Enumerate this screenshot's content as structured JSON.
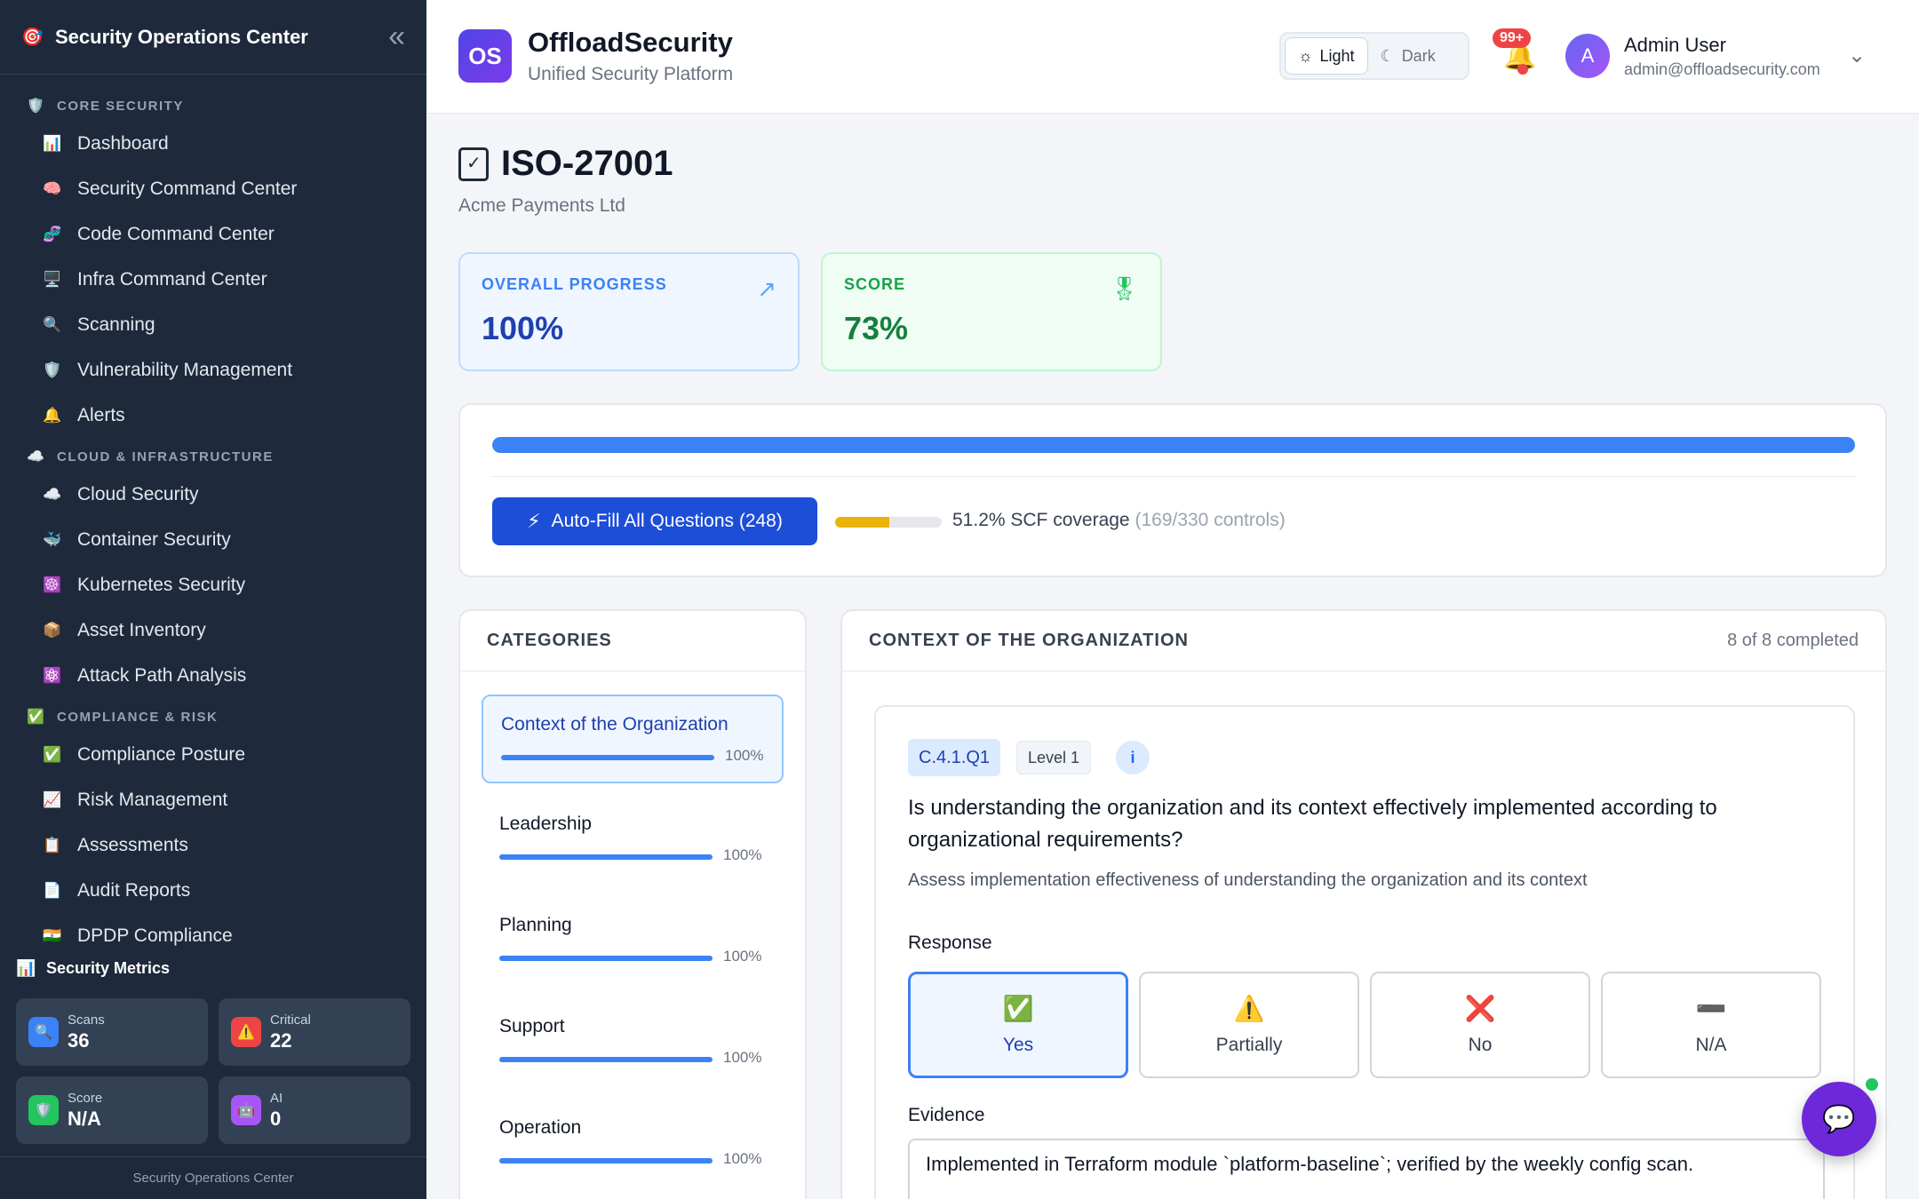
{
  "sidebar": {
    "title": "Security Operations Center",
    "sections": [
      {
        "label": "CORE SECURITY",
        "icon": "shield-icon",
        "items": [
          {
            "label": "Dashboard",
            "icon": "bar-chart-icon"
          },
          {
            "label": "Security Command Center",
            "icon": "brain-icon"
          },
          {
            "label": "Code Command Center",
            "icon": "dna-icon"
          },
          {
            "label": "Infra Command Center",
            "icon": "monitor-icon"
          },
          {
            "label": "Scanning",
            "icon": "magnifier-icon"
          },
          {
            "label": "Vulnerability Management",
            "icon": "shield-icon"
          },
          {
            "label": "Alerts",
            "icon": "bell-icon"
          }
        ]
      },
      {
        "label": "CLOUD & INFRASTRUCTURE",
        "icon": "cloud-icon",
        "items": [
          {
            "label": "Cloud Security",
            "icon": "cloud-icon"
          },
          {
            "label": "Container Security",
            "icon": "whale-icon"
          },
          {
            "label": "Kubernetes Security",
            "icon": "kubernetes-icon"
          },
          {
            "label": "Asset Inventory",
            "icon": "package-icon"
          },
          {
            "label": "Attack Path Analysis",
            "icon": "atom-icon"
          }
        ]
      },
      {
        "label": "COMPLIANCE & RISK",
        "icon": "check-box-icon",
        "items": [
          {
            "label": "Compliance Posture",
            "icon": "check-box-icon"
          },
          {
            "label": "Risk Management",
            "icon": "chart-up-icon"
          },
          {
            "label": "Assessments",
            "icon": "clipboard-icon"
          },
          {
            "label": "Audit Reports",
            "icon": "document-icon"
          },
          {
            "label": "DPDP Compliance",
            "icon": "india-flag-icon"
          }
        ]
      }
    ],
    "metrics_title": "Security Metrics",
    "metrics": [
      {
        "label": "Scans",
        "value": "36",
        "icon": "magnifier-icon",
        "color": "#3b82f6"
      },
      {
        "label": "Critical",
        "value": "22",
        "icon": "warning-icon",
        "color": "#ef4444"
      },
      {
        "label": "Score",
        "value": "N/A",
        "icon": "shield-icon",
        "color": "#22c55e"
      },
      {
        "label": "AI",
        "value": "0",
        "icon": "robot-icon",
        "color": "#a855f7"
      }
    ],
    "footer": "Security Operations Center"
  },
  "header": {
    "badge": "OS",
    "brand": "OffloadSecurity",
    "tagline": "Unified Security Platform",
    "theme_light": "Light",
    "theme_dark": "Dark",
    "notif_count": "99+",
    "avatar_letter": "A",
    "user_name": "Admin User",
    "user_email": "admin@offloadsecurity.com"
  },
  "page": {
    "title": "ISO-27001",
    "subtitle": "Acme Payments Ltd",
    "progress_label": "OVERALL PROGRESS",
    "progress_value": "100%",
    "progress_fraction": 1.0,
    "score_label": "SCORE",
    "score_value": "73%",
    "autofill_label": "Auto-Fill All Questions (248)",
    "coverage_fraction": 0.512,
    "coverage_text": "51.2% SCF coverage",
    "coverage_detail": "(169/330 controls)"
  },
  "categories": {
    "title": "CATEGORIES",
    "items": [
      {
        "name": "Context of the Organization",
        "percent": "100%",
        "fraction": 1.0
      },
      {
        "name": "Leadership",
        "percent": "100%",
        "fraction": 1.0
      },
      {
        "name": "Planning",
        "percent": "100%",
        "fraction": 1.0
      },
      {
        "name": "Support",
        "percent": "100%",
        "fraction": 1.0
      },
      {
        "name": "Operation",
        "percent": "100%",
        "fraction": 1.0
      }
    ]
  },
  "question_panel": {
    "title": "CONTEXT OF THE ORGANIZATION",
    "completed": "8 of 8 completed",
    "code": "C.4.1.Q1",
    "level": "Level 1",
    "question": "Is understanding the organization and its context effectively implemented according to organizational requirements?",
    "description": "Assess implementation effectiveness of understanding the organization and its context",
    "response_label": "Response",
    "options": [
      {
        "label": "Yes",
        "icon": "✅"
      },
      {
        "label": "Partially",
        "icon": "⚠️"
      },
      {
        "label": "No",
        "icon": "❌"
      },
      {
        "label": "N/A",
        "icon": "➖"
      }
    ],
    "evidence_label": "Evidence",
    "evidence_value": "Implemented in Terraform module `platform-baseline`; verified by the weekly config scan."
  }
}
